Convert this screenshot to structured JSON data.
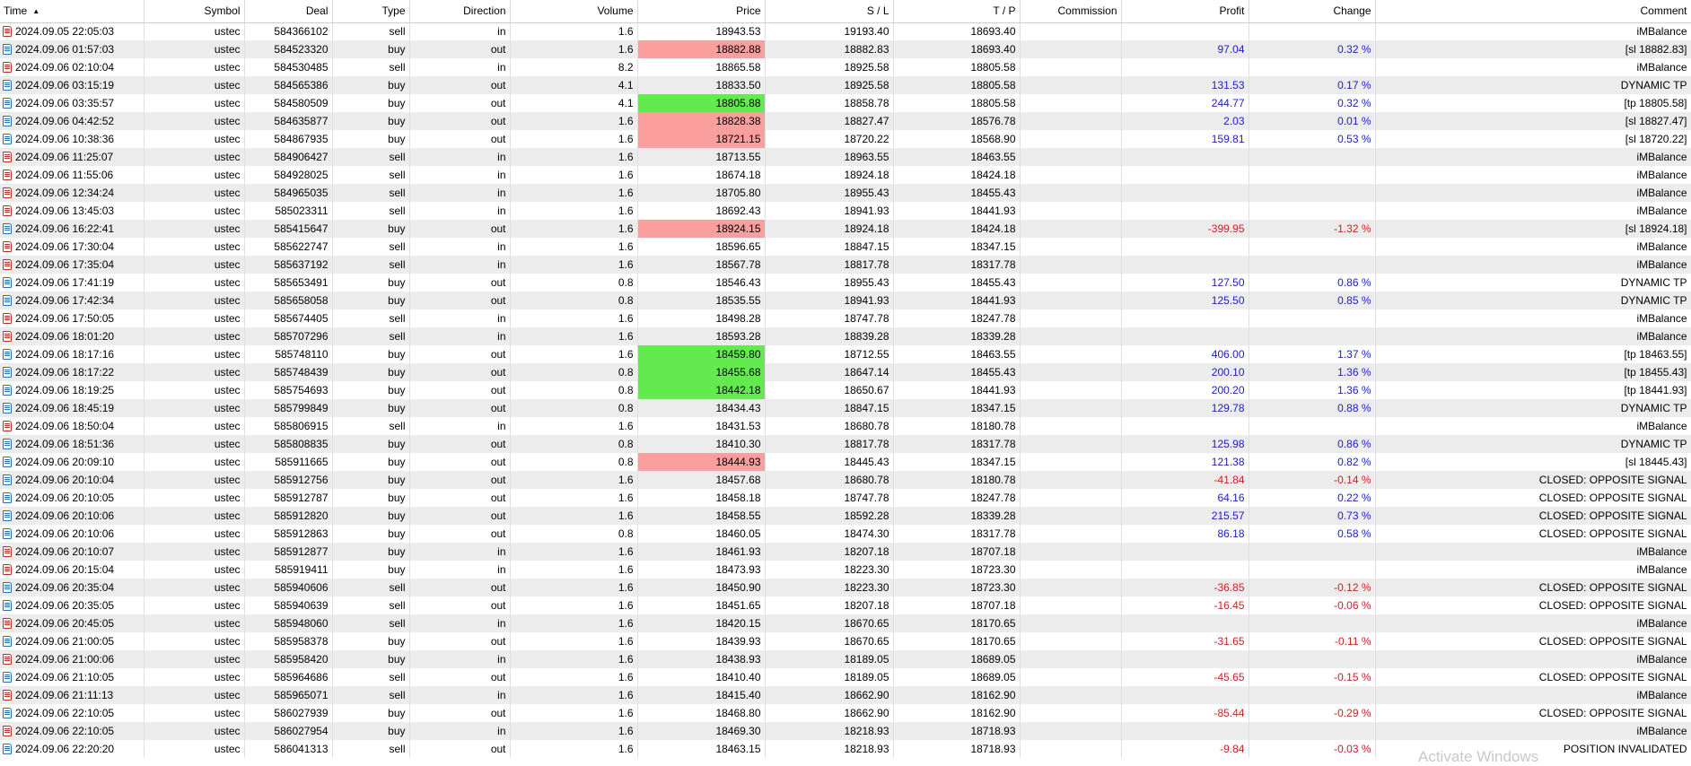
{
  "columns": {
    "time": "Time",
    "symbol": "Symbol",
    "deal": "Deal",
    "type": "Type",
    "direction": "Direction",
    "volume": "Volume",
    "price": "Price",
    "sl": "S / L",
    "tp": "T / P",
    "commission": "Commission",
    "profit": "Profit",
    "change": "Change",
    "comment": "Comment"
  },
  "watermark": "Activate Windows",
  "colors": {
    "loss_highlight": "#fa9e9e",
    "profit_highlight": "#63ea4f",
    "positive": "#1a1ad6",
    "negative": "#d21f1f"
  },
  "rows": [
    {
      "time": "2024.09.05 22:05:03",
      "symbol": "ustec",
      "deal": "584366102",
      "type": "sell",
      "direction": "in",
      "volume": "1.6",
      "price": "18943.53",
      "sl": "19193.40",
      "tp": "18693.40",
      "commission": "",
      "profit": "",
      "change": "",
      "comment": "iMBalance",
      "hl": ""
    },
    {
      "time": "2024.09.06 01:57:03",
      "symbol": "ustec",
      "deal": "584523320",
      "type": "buy",
      "direction": "out",
      "volume": "1.6",
      "price": "18882.88",
      "sl": "18882.83",
      "tp": "18693.40",
      "commission": "",
      "profit": "97.04",
      "change": "0.32 %",
      "comment": "[sl 18882.83]",
      "hl": "red"
    },
    {
      "time": "2024.09.06 02:10:04",
      "symbol": "ustec",
      "deal": "584530485",
      "type": "sell",
      "direction": "in",
      "volume": "8.2",
      "price": "18865.58",
      "sl": "18925.58",
      "tp": "18805.58",
      "commission": "",
      "profit": "",
      "change": "",
      "comment": "iMBalance",
      "hl": ""
    },
    {
      "time": "2024.09.06 03:15:19",
      "symbol": "ustec",
      "deal": "584565386",
      "type": "buy",
      "direction": "out",
      "volume": "4.1",
      "price": "18833.50",
      "sl": "18925.58",
      "tp": "18805.58",
      "commission": "",
      "profit": "131.53",
      "change": "0.17 %",
      "comment": "DYNAMIC TP",
      "hl": ""
    },
    {
      "time": "2024.09.06 03:35:57",
      "symbol": "ustec",
      "deal": "584580509",
      "type": "buy",
      "direction": "out",
      "volume": "4.1",
      "price": "18805.88",
      "sl": "18858.78",
      "tp": "18805.58",
      "commission": "",
      "profit": "244.77",
      "change": "0.32 %",
      "comment": "[tp 18805.58]",
      "hl": "green"
    },
    {
      "time": "2024.09.06 04:42:52",
      "symbol": "ustec",
      "deal": "584635877",
      "type": "buy",
      "direction": "out",
      "volume": "1.6",
      "price": "18828.38",
      "sl": "18827.47",
      "tp": "18576.78",
      "commission": "",
      "profit": "2.03",
      "change": "0.01 %",
      "comment": "[sl 18827.47]",
      "hl": "red"
    },
    {
      "time": "2024.09.06 10:38:36",
      "symbol": "ustec",
      "deal": "584867935",
      "type": "buy",
      "direction": "out",
      "volume": "1.6",
      "price": "18721.15",
      "sl": "18720.22",
      "tp": "18568.90",
      "commission": "",
      "profit": "159.81",
      "change": "0.53 %",
      "comment": "[sl 18720.22]",
      "hl": "red"
    },
    {
      "time": "2024.09.06 11:25:07",
      "symbol": "ustec",
      "deal": "584906427",
      "type": "sell",
      "direction": "in",
      "volume": "1.6",
      "price": "18713.55",
      "sl": "18963.55",
      "tp": "18463.55",
      "commission": "",
      "profit": "",
      "change": "",
      "comment": "iMBalance",
      "hl": ""
    },
    {
      "time": "2024.09.06 11:55:06",
      "symbol": "ustec",
      "deal": "584928025",
      "type": "sell",
      "direction": "in",
      "volume": "1.6",
      "price": "18674.18",
      "sl": "18924.18",
      "tp": "18424.18",
      "commission": "",
      "profit": "",
      "change": "",
      "comment": "iMBalance",
      "hl": ""
    },
    {
      "time": "2024.09.06 12:34:24",
      "symbol": "ustec",
      "deal": "584965035",
      "type": "sell",
      "direction": "in",
      "volume": "1.6",
      "price": "18705.80",
      "sl": "18955.43",
      "tp": "18455.43",
      "commission": "",
      "profit": "",
      "change": "",
      "comment": "iMBalance",
      "hl": ""
    },
    {
      "time": "2024.09.06 13:45:03",
      "symbol": "ustec",
      "deal": "585023311",
      "type": "sell",
      "direction": "in",
      "volume": "1.6",
      "price": "18692.43",
      "sl": "18941.93",
      "tp": "18441.93",
      "commission": "",
      "profit": "",
      "change": "",
      "comment": "iMBalance",
      "hl": ""
    },
    {
      "time": "2024.09.06 16:22:41",
      "symbol": "ustec",
      "deal": "585415647",
      "type": "buy",
      "direction": "out",
      "volume": "1.6",
      "price": "18924.15",
      "sl": "18924.18",
      "tp": "18424.18",
      "commission": "",
      "profit": "-399.95",
      "change": "-1.32 %",
      "comment": "[sl 18924.18]",
      "hl": "red"
    },
    {
      "time": "2024.09.06 17:30:04",
      "symbol": "ustec",
      "deal": "585622747",
      "type": "sell",
      "direction": "in",
      "volume": "1.6",
      "price": "18596.65",
      "sl": "18847.15",
      "tp": "18347.15",
      "commission": "",
      "profit": "",
      "change": "",
      "comment": "iMBalance",
      "hl": ""
    },
    {
      "time": "2024.09.06 17:35:04",
      "symbol": "ustec",
      "deal": "585637192",
      "type": "sell",
      "direction": "in",
      "volume": "1.6",
      "price": "18567.78",
      "sl": "18817.78",
      "tp": "18317.78",
      "commission": "",
      "profit": "",
      "change": "",
      "comment": "iMBalance",
      "hl": ""
    },
    {
      "time": "2024.09.06 17:41:19",
      "symbol": "ustec",
      "deal": "585653491",
      "type": "buy",
      "direction": "out",
      "volume": "0.8",
      "price": "18546.43",
      "sl": "18955.43",
      "tp": "18455.43",
      "commission": "",
      "profit": "127.50",
      "change": "0.86 %",
      "comment": "DYNAMIC TP",
      "hl": ""
    },
    {
      "time": "2024.09.06 17:42:34",
      "symbol": "ustec",
      "deal": "585658058",
      "type": "buy",
      "direction": "out",
      "volume": "0.8",
      "price": "18535.55",
      "sl": "18941.93",
      "tp": "18441.93",
      "commission": "",
      "profit": "125.50",
      "change": "0.85 %",
      "comment": "DYNAMIC TP",
      "hl": ""
    },
    {
      "time": "2024.09.06 17:50:05",
      "symbol": "ustec",
      "deal": "585674405",
      "type": "sell",
      "direction": "in",
      "volume": "1.6",
      "price": "18498.28",
      "sl": "18747.78",
      "tp": "18247.78",
      "commission": "",
      "profit": "",
      "change": "",
      "comment": "iMBalance",
      "hl": ""
    },
    {
      "time": "2024.09.06 18:01:20",
      "symbol": "ustec",
      "deal": "585707296",
      "type": "sell",
      "direction": "in",
      "volume": "1.6",
      "price": "18593.28",
      "sl": "18839.28",
      "tp": "18339.28",
      "commission": "",
      "profit": "",
      "change": "",
      "comment": "iMBalance",
      "hl": ""
    },
    {
      "time": "2024.09.06 18:17:16",
      "symbol": "ustec",
      "deal": "585748110",
      "type": "buy",
      "direction": "out",
      "volume": "1.6",
      "price": "18459.80",
      "sl": "18712.55",
      "tp": "18463.55",
      "commission": "",
      "profit": "406.00",
      "change": "1.37 %",
      "comment": "[tp 18463.55]",
      "hl": "green"
    },
    {
      "time": "2024.09.06 18:17:22",
      "symbol": "ustec",
      "deal": "585748439",
      "type": "buy",
      "direction": "out",
      "volume": "0.8",
      "price": "18455.68",
      "sl": "18647.14",
      "tp": "18455.43",
      "commission": "",
      "profit": "200.10",
      "change": "1.36 %",
      "comment": "[tp 18455.43]",
      "hl": "green"
    },
    {
      "time": "2024.09.06 18:19:25",
      "symbol": "ustec",
      "deal": "585754693",
      "type": "buy",
      "direction": "out",
      "volume": "0.8",
      "price": "18442.18",
      "sl": "18650.67",
      "tp": "18441.93",
      "commission": "",
      "profit": "200.20",
      "change": "1.36 %",
      "comment": "[tp 18441.93]",
      "hl": "green"
    },
    {
      "time": "2024.09.06 18:45:19",
      "symbol": "ustec",
      "deal": "585799849",
      "type": "buy",
      "direction": "out",
      "volume": "0.8",
      "price": "18434.43",
      "sl": "18847.15",
      "tp": "18347.15",
      "commission": "",
      "profit": "129.78",
      "change": "0.88 %",
      "comment": "DYNAMIC TP",
      "hl": ""
    },
    {
      "time": "2024.09.06 18:50:04",
      "symbol": "ustec",
      "deal": "585806915",
      "type": "sell",
      "direction": "in",
      "volume": "1.6",
      "price": "18431.53",
      "sl": "18680.78",
      "tp": "18180.78",
      "commission": "",
      "profit": "",
      "change": "",
      "comment": "iMBalance",
      "hl": ""
    },
    {
      "time": "2024.09.06 18:51:36",
      "symbol": "ustec",
      "deal": "585808835",
      "type": "buy",
      "direction": "out",
      "volume": "0.8",
      "price": "18410.30",
      "sl": "18817.78",
      "tp": "18317.78",
      "commission": "",
      "profit": "125.98",
      "change": "0.86 %",
      "comment": "DYNAMIC TP",
      "hl": ""
    },
    {
      "time": "2024.09.06 20:09:10",
      "symbol": "ustec",
      "deal": "585911665",
      "type": "buy",
      "direction": "out",
      "volume": "0.8",
      "price": "18444.93",
      "sl": "18445.43",
      "tp": "18347.15",
      "commission": "",
      "profit": "121.38",
      "change": "0.82 %",
      "comment": "[sl 18445.43]",
      "hl": "red"
    },
    {
      "time": "2024.09.06 20:10:04",
      "symbol": "ustec",
      "deal": "585912756",
      "type": "buy",
      "direction": "out",
      "volume": "1.6",
      "price": "18457.68",
      "sl": "18680.78",
      "tp": "18180.78",
      "commission": "",
      "profit": "-41.84",
      "change": "-0.14 %",
      "comment": "CLOSED: OPPOSITE SIGNAL",
      "hl": ""
    },
    {
      "time": "2024.09.06 20:10:05",
      "symbol": "ustec",
      "deal": "585912787",
      "type": "buy",
      "direction": "out",
      "volume": "1.6",
      "price": "18458.18",
      "sl": "18747.78",
      "tp": "18247.78",
      "commission": "",
      "profit": "64.16",
      "change": "0.22 %",
      "comment": "CLOSED: OPPOSITE SIGNAL",
      "hl": ""
    },
    {
      "time": "2024.09.06 20:10:06",
      "symbol": "ustec",
      "deal": "585912820",
      "type": "buy",
      "direction": "out",
      "volume": "1.6",
      "price": "18458.55",
      "sl": "18592.28",
      "tp": "18339.28",
      "commission": "",
      "profit": "215.57",
      "change": "0.73 %",
      "comment": "CLOSED: OPPOSITE SIGNAL",
      "hl": ""
    },
    {
      "time": "2024.09.06 20:10:06",
      "symbol": "ustec",
      "deal": "585912863",
      "type": "buy",
      "direction": "out",
      "volume": "0.8",
      "price": "18460.05",
      "sl": "18474.30",
      "tp": "18317.78",
      "commission": "",
      "profit": "86.18",
      "change": "0.58 %",
      "comment": "CLOSED: OPPOSITE SIGNAL",
      "hl": ""
    },
    {
      "time": "2024.09.06 20:10:07",
      "symbol": "ustec",
      "deal": "585912877",
      "type": "buy",
      "direction": "in",
      "volume": "1.6",
      "price": "18461.93",
      "sl": "18207.18",
      "tp": "18707.18",
      "commission": "",
      "profit": "",
      "change": "",
      "comment": "iMBalance",
      "hl": ""
    },
    {
      "time": "2024.09.06 20:15:04",
      "symbol": "ustec",
      "deal": "585919411",
      "type": "buy",
      "direction": "in",
      "volume": "1.6",
      "price": "18473.93",
      "sl": "18223.30",
      "tp": "18723.30",
      "commission": "",
      "profit": "",
      "change": "",
      "comment": "iMBalance",
      "hl": ""
    },
    {
      "time": "2024.09.06 20:35:04",
      "symbol": "ustec",
      "deal": "585940606",
      "type": "sell",
      "direction": "out",
      "volume": "1.6",
      "price": "18450.90",
      "sl": "18223.30",
      "tp": "18723.30",
      "commission": "",
      "profit": "-36.85",
      "change": "-0.12 %",
      "comment": "CLOSED: OPPOSITE SIGNAL",
      "hl": ""
    },
    {
      "time": "2024.09.06 20:35:05",
      "symbol": "ustec",
      "deal": "585940639",
      "type": "sell",
      "direction": "out",
      "volume": "1.6",
      "price": "18451.65",
      "sl": "18207.18",
      "tp": "18707.18",
      "commission": "",
      "profit": "-16.45",
      "change": "-0.06 %",
      "comment": "CLOSED: OPPOSITE SIGNAL",
      "hl": ""
    },
    {
      "time": "2024.09.06 20:45:05",
      "symbol": "ustec",
      "deal": "585948060",
      "type": "sell",
      "direction": "in",
      "volume": "1.6",
      "price": "18420.15",
      "sl": "18670.65",
      "tp": "18170.65",
      "commission": "",
      "profit": "",
      "change": "",
      "comment": "iMBalance",
      "hl": ""
    },
    {
      "time": "2024.09.06 21:00:05",
      "symbol": "ustec",
      "deal": "585958378",
      "type": "buy",
      "direction": "out",
      "volume": "1.6",
      "price": "18439.93",
      "sl": "18670.65",
      "tp": "18170.65",
      "commission": "",
      "profit": "-31.65",
      "change": "-0.11 %",
      "comment": "CLOSED: OPPOSITE SIGNAL",
      "hl": ""
    },
    {
      "time": "2024.09.06 21:00:06",
      "symbol": "ustec",
      "deal": "585958420",
      "type": "buy",
      "direction": "in",
      "volume": "1.6",
      "price": "18438.93",
      "sl": "18189.05",
      "tp": "18689.05",
      "commission": "",
      "profit": "",
      "change": "",
      "comment": "iMBalance",
      "hl": ""
    },
    {
      "time": "2024.09.06 21:10:05",
      "symbol": "ustec",
      "deal": "585964686",
      "type": "sell",
      "direction": "out",
      "volume": "1.6",
      "price": "18410.40",
      "sl": "18189.05",
      "tp": "18689.05",
      "commission": "",
      "profit": "-45.65",
      "change": "-0.15 %",
      "comment": "CLOSED: OPPOSITE SIGNAL",
      "hl": ""
    },
    {
      "time": "2024.09.06 21:11:13",
      "symbol": "ustec",
      "deal": "585965071",
      "type": "sell",
      "direction": "in",
      "volume": "1.6",
      "price": "18415.40",
      "sl": "18662.90",
      "tp": "18162.90",
      "commission": "",
      "profit": "",
      "change": "",
      "comment": "iMBalance",
      "hl": ""
    },
    {
      "time": "2024.09.06 22:10:05",
      "symbol": "ustec",
      "deal": "586027939",
      "type": "buy",
      "direction": "out",
      "volume": "1.6",
      "price": "18468.80",
      "sl": "18662.90",
      "tp": "18162.90",
      "commission": "",
      "profit": "-85.44",
      "change": "-0.29 %",
      "comment": "CLOSED: OPPOSITE SIGNAL",
      "hl": ""
    },
    {
      "time": "2024.09.06 22:10:05",
      "symbol": "ustec",
      "deal": "586027954",
      "type": "buy",
      "direction": "in",
      "volume": "1.6",
      "price": "18469.30",
      "sl": "18218.93",
      "tp": "18718.93",
      "commission": "",
      "profit": "",
      "change": "",
      "comment": "iMBalance",
      "hl": ""
    },
    {
      "time": "2024.09.06 22:20:20",
      "symbol": "ustec",
      "deal": "586041313",
      "type": "sell",
      "direction": "out",
      "volume": "1.6",
      "price": "18463.15",
      "sl": "18218.93",
      "tp": "18718.93",
      "commission": "",
      "profit": "-9.84",
      "change": "-0.03 %",
      "comment": "POSITION INVALIDATED",
      "hl": ""
    }
  ]
}
